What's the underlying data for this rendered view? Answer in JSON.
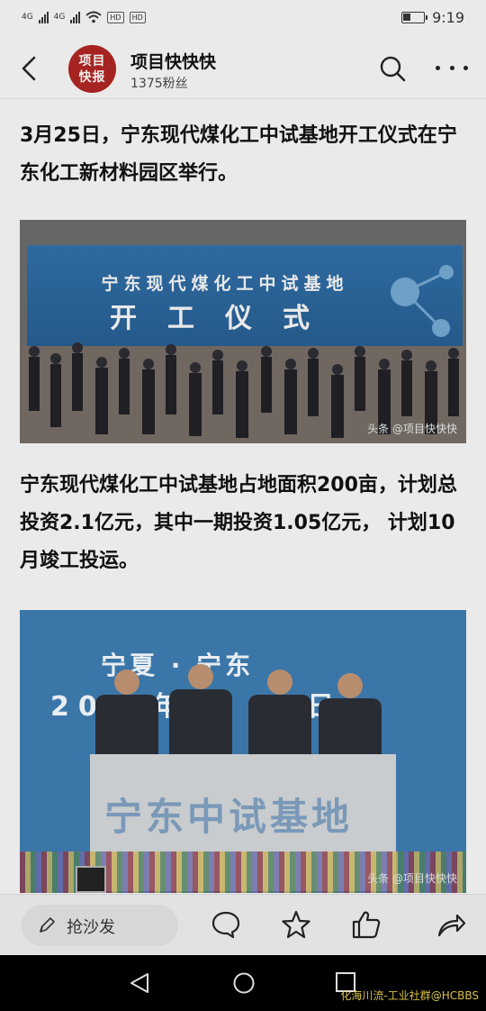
{
  "status_bar": {
    "network_1": "4G",
    "network_2": "4G",
    "tag_1": "HD",
    "tag_2": "HD",
    "time": "9:19",
    "battery_level": 0.4
  },
  "header": {
    "logo_line1": "项目",
    "logo_line2": "快报",
    "account_name": "项目快快快",
    "followers": "1375粉丝"
  },
  "article": {
    "paragraph1": "3月25日，宁东现代煤化工中试基地开工仪式在宁东化工新材料园区举行。",
    "photo1": {
      "banner_line1": "宁东现代煤化工中试基地",
      "banner_line2": "开工仪式",
      "watermark": "头条 @项目快快快"
    },
    "paragraph2": "宁东现代煤化工中试基地占地面积200亩，计划总投资2.1亿元，其中一期投资1.05亿元， 计划10月竣工投运。",
    "photo2": {
      "line1": "宁夏 · 宁东",
      "line2": "202 年  月 2  日",
      "podium_text": "宁东中试基地",
      "watermark": "头条 @项目快快快"
    }
  },
  "action_bar": {
    "comment_placeholder": "抢沙发"
  },
  "footer_watermark": "化海川流-工业社群@HCBBS"
}
